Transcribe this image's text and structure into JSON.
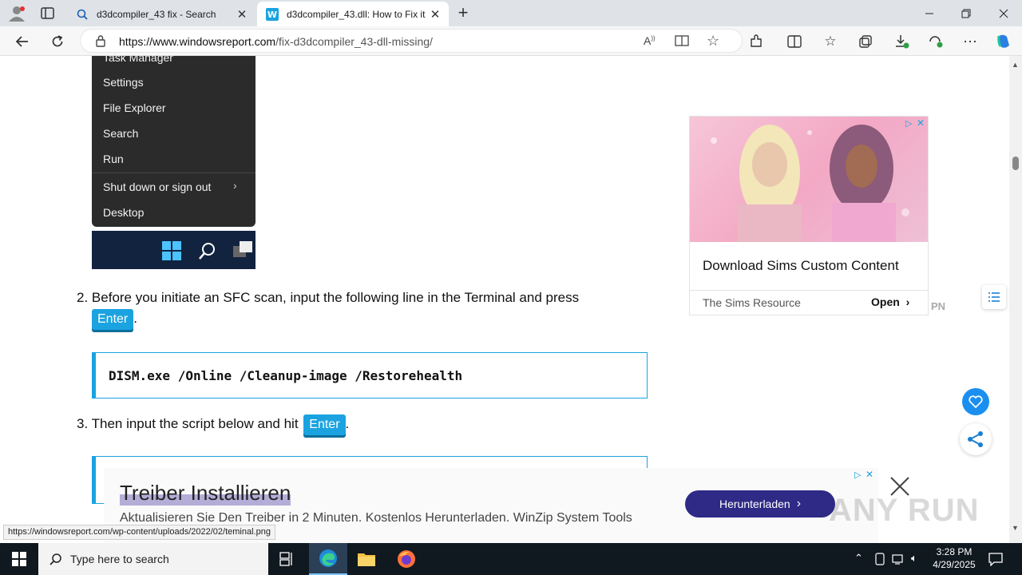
{
  "browser": {
    "tabs": [
      {
        "title": "d3dcompiler_43 fix - Search",
        "active": false
      },
      {
        "title": "d3dcompiler_43.dll: How to Fix it",
        "active": true
      }
    ],
    "url_host": "https://www.windowsreport.com",
    "url_path": "/fix-d3dcompiler_43-dll-missing/"
  },
  "context_menu": {
    "items": [
      "Task Manager",
      "Settings",
      "File Explorer",
      "Search",
      "Run",
      "Shut down or sign out",
      "Desktop"
    ]
  },
  "article": {
    "step2_num": "2.",
    "step2_text": "Before you initiate an SFC scan, input the following line in the Terminal and press",
    "enter_key": "Enter",
    "code1": "DISM.exe /Online /Cleanup-image /Restorehealth",
    "step3_num": "3.",
    "step3_text": "Then input the script below and hit"
  },
  "ad_right": {
    "headline": "Download Sims Custom Content",
    "advertiser": "The Sims Resource",
    "cta": "Open"
  },
  "ad_bottom": {
    "headline": "Treiber Installieren",
    "subtext": "Aktualisieren Sie Den Treiber in 2 Minuten. Kostenlos Herunterladen. WinZip System Tools",
    "cta": "Herunterladen"
  },
  "status_url": "https://windowsreport.com/wp-content/uploads/2022/02/teminal.png",
  "taskbar": {
    "search_placeholder": "Type here to search",
    "time": "3:28 PM",
    "date": "4/29/2025"
  },
  "watermark": "ANY RUN",
  "colors": {
    "accent": "#1aa3e0",
    "cta_bottom": "#2e2a86",
    "taskbar": "#101820"
  }
}
